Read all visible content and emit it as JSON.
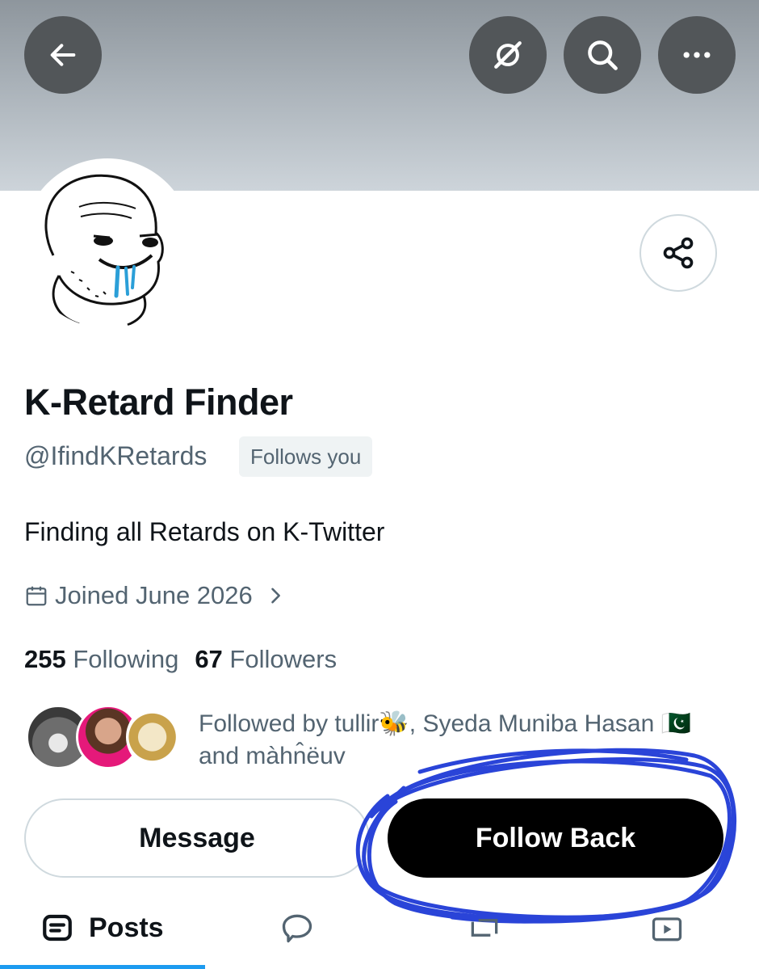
{
  "header": {
    "back_icon": "arrow-left-icon",
    "action_icons": [
      "grok-icon",
      "search-icon",
      "more-icon"
    ]
  },
  "profile": {
    "display_name": "K-Retard Finder",
    "handle": "@IfindKRetards",
    "follows_you": "Follows you",
    "bio": "Finding all Retards on K-Twitter",
    "joined": "Joined June 2026",
    "following_count": "255",
    "following_label": "Following",
    "followers_count": "67",
    "followers_label": "Followers",
    "followed_by_line1": "Followed by tullir🐝, Syeda Muniba Hasan 🇵🇰",
    "followed_by_line2": "and màhn̂ëuv"
  },
  "actions": {
    "message": "Message",
    "follow_back": "Follow Back"
  },
  "tabs": [
    {
      "label": "Posts",
      "icon": "posts-icon",
      "active": true
    },
    {
      "label": "",
      "icon": "replies-icon",
      "active": false
    },
    {
      "label": "",
      "icon": "highlights-icon",
      "active": false
    },
    {
      "label": "",
      "icon": "media-icon",
      "active": false
    }
  ],
  "colors": {
    "accent": "#1d9bf0",
    "annotation_scribble": "#1f3bd6",
    "secondary_text": "#536471"
  }
}
